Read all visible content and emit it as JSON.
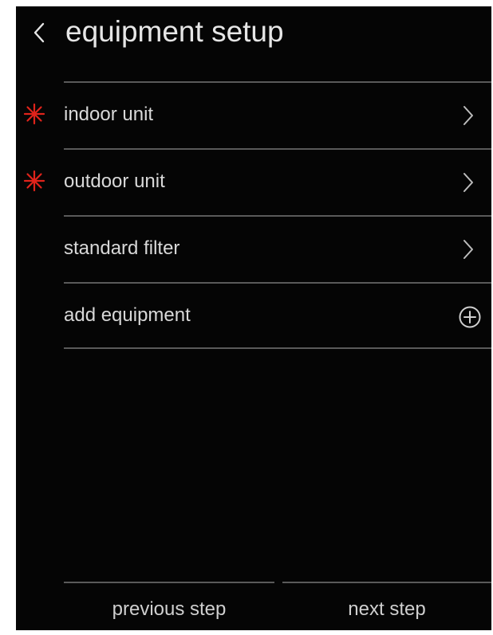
{
  "header": {
    "title": "equipment setup"
  },
  "list": {
    "items": [
      {
        "label": "indoor unit",
        "required": true,
        "icon": "chevron-right-icon"
      },
      {
        "label": "outdoor unit",
        "required": true,
        "icon": "chevron-right-icon"
      },
      {
        "label": "standard filter",
        "required": false,
        "icon": "chevron-right-icon"
      },
      {
        "label": "add equipment",
        "required": false,
        "icon": "plus-circle-icon"
      }
    ]
  },
  "footer": {
    "previous_label": "previous step",
    "next_label": "next step"
  },
  "colors": {
    "background": "#050505",
    "text": "#d8d8d8",
    "divider": "#5a5a5a",
    "required": "#e0231b"
  }
}
